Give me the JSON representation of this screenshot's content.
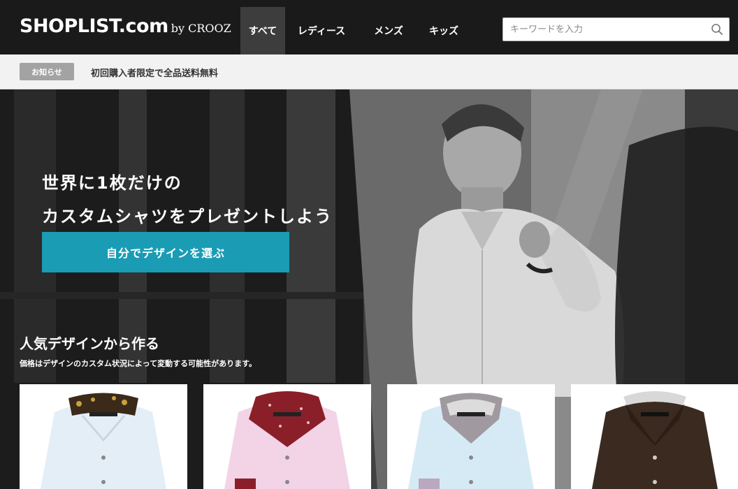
{
  "header": {
    "logo_main": "SHOPLIST.com",
    "logo_sub": "by CROOZ",
    "nav_tabs": [
      {
        "label": "すべて",
        "active": true
      },
      {
        "label": "レディース",
        "active": false
      },
      {
        "label": "メンズ",
        "active": false
      },
      {
        "label": "キッズ",
        "active": false
      }
    ],
    "search_placeholder": "キーワードを入力",
    "search_icon": "search-icon"
  },
  "notice": {
    "badge": "お知らせ",
    "text": "初回購入者限定で全品送料無料"
  },
  "hero": {
    "headline_line1": "世界に1枚だけの",
    "headline_line2": "カスタムシャツをプレゼントしよう",
    "cta_label": "自分でデザインを選ぶ",
    "cta_color": "#1a9cb4"
  },
  "popular": {
    "title": "人気デザインから作る",
    "subtitle": "価格はデザインのカスタム状況によって変動する可能性があります。",
    "products": [
      {
        "shirt_color": "#e4eef7",
        "collar_color": "#3b2a1a",
        "accent": "floral-collar-lining"
      },
      {
        "shirt_color": "#f2d4e6",
        "collar_color": "#8a1f2a",
        "accent": "floral-collar-and-cuff"
      },
      {
        "shirt_color": "#d6eaf6",
        "collar_color": "#a09aa0",
        "accent": "grey-collar-lining"
      },
      {
        "shirt_color": "#3a2a20",
        "collar_color": "#d8d8d8",
        "accent": "white-collar-lining"
      }
    ]
  },
  "colors": {
    "header_bg": "#1a1a1a",
    "notice_bg": "#f2f2f2",
    "badge_bg": "#a3a3a3"
  }
}
